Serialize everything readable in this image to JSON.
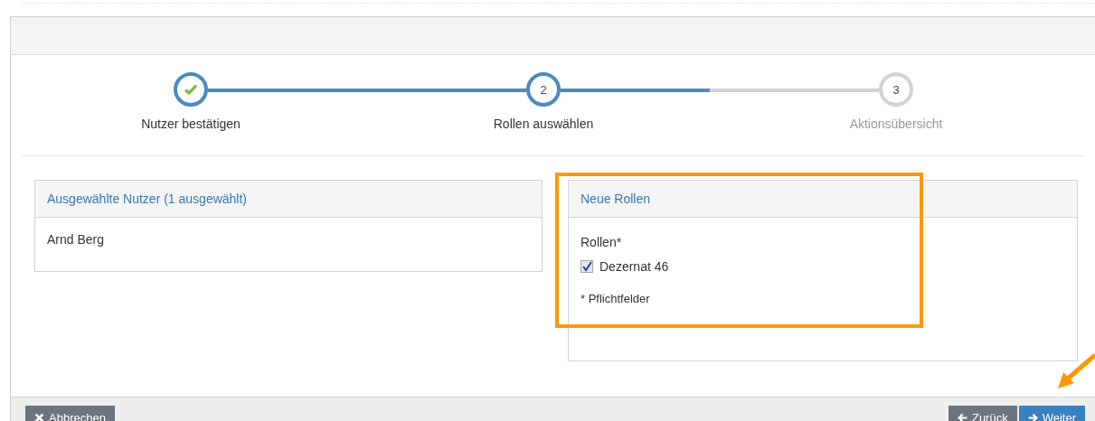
{
  "steps": [
    {
      "label": "Nutzer bestätigen",
      "kind": "done"
    },
    {
      "number": "2",
      "label": "Rollen auswählen",
      "kind": "current"
    },
    {
      "number": "3",
      "label": "Aktionsübersicht",
      "kind": "pending"
    }
  ],
  "connectors": [
    {
      "level": 1
    },
    {
      "level": 0.47
    }
  ],
  "selected_users": {
    "title": "Ausgewählte Nutzer (1 ausgewählt)",
    "users": [
      "Arnd Berg"
    ]
  },
  "new_roles": {
    "title": "Neue Rollen",
    "field_label": "Rollen*",
    "options": [
      {
        "label": "Dezernat 46",
        "checked": true
      }
    ],
    "note": "* Pflichtfelder"
  },
  "footer": {
    "cancel": "Abbrechen",
    "back": "Zurück",
    "next": "Weiter"
  }
}
